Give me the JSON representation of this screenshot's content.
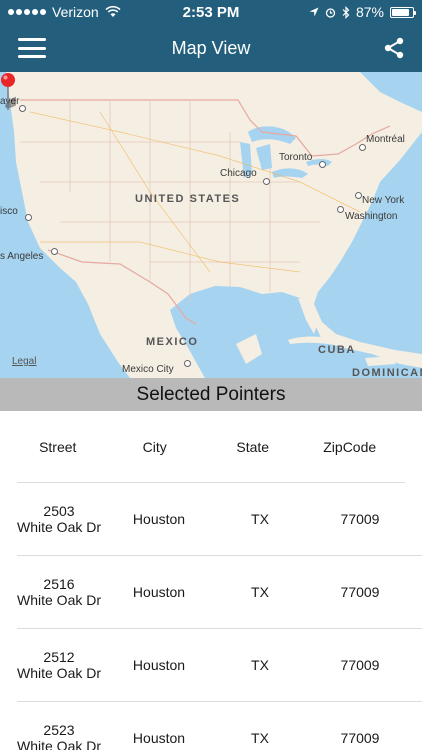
{
  "status_bar": {
    "carrier": "Verizon",
    "time": "2:53 PM",
    "battery_percent": "87%",
    "battery_level": 0.87
  },
  "nav": {
    "title": "Map View",
    "menu_icon": "hamburger-menu-icon",
    "share_icon": "share-icon"
  },
  "map": {
    "labels": {
      "country_us": "UNITED STATES",
      "country_mexico": "MEXICO",
      "country_cuba": "CUBA",
      "country_dominican": "DOMINICAN",
      "city_chicago": "Chicago",
      "city_toronto": "Toronto",
      "city_montreal": "Montréal",
      "city_newyork": "New York",
      "city_washington": "Washington",
      "city_losangeles": "s Angeles",
      "city_sanfrancisco": "isco",
      "city_vancouver": "aver",
      "city_mexicocity": "Mexico City"
    },
    "legal": "Legal",
    "colors": {
      "land": "#f4eee3",
      "water": "#a6d3ef",
      "pin": "#e8262a",
      "border": "#e7a8a0"
    }
  },
  "section": {
    "title": "Selected Pointers"
  },
  "table": {
    "headers": {
      "street": "Street",
      "city": "City",
      "state": "State",
      "zip": "ZipCode"
    },
    "rows": [
      {
        "street_line1": "2503",
        "street_line2": "White Oak Dr",
        "city": "Houston",
        "state": "TX",
        "zip": "77009"
      },
      {
        "street_line1": "2516",
        "street_line2": "White Oak Dr",
        "city": "Houston",
        "state": "TX",
        "zip": "77009"
      },
      {
        "street_line1": "2512",
        "street_line2": "White Oak Dr",
        "city": "Houston",
        "state": "TX",
        "zip": "77009"
      },
      {
        "street_line1": "2523",
        "street_line2": "White Oak Dr",
        "city": "Houston",
        "state": "TX",
        "zip": "77009"
      }
    ]
  },
  "theme": {
    "header_bg": "#235f7d",
    "section_bg": "#b9b9b9"
  }
}
